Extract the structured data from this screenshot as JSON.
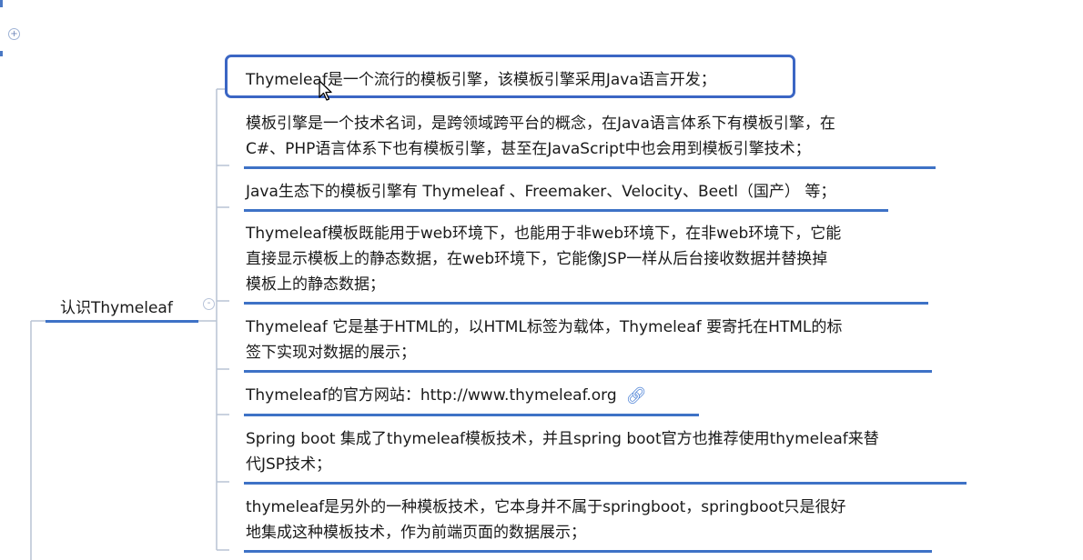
{
  "central_topic": {
    "label": "认识Thymeleaf"
  },
  "topics": [
    {
      "lines": [
        "Thymeleaf是一个流行的模板引擎，该模板引擎采用Java语言开发；"
      ]
    },
    {
      "lines": [
        "模板引擎是一个技术名词，是跨领域跨平台的概念，在Java语言体系下有模板引擎，在",
        "C#、PHP语言体系下也有模板引擎，甚至在JavaScript中也会用到模板引擎技术；"
      ]
    },
    {
      "lines": [
        "Java生态下的模板引擎有 Thymeleaf 、Freemaker、Velocity、Beetl（国产） 等；"
      ]
    },
    {
      "lines": [
        "Thymeleaf模板既能用于web环境下，也能用于非web环境下，在非web环境下，它能",
        "直接显示模板上的静态数据，在web环境下，它能像JSP一样从后台接收数据并替换掉",
        "模板上的静态数据；"
      ]
    },
    {
      "lines": [
        "Thymeleaf 它是基于HTML的，以HTML标签为载体，Thymeleaf 要寄托在HTML的标",
        "签下实现对数据的展示；"
      ]
    },
    {
      "lines": [
        "Thymeleaf的官方网站：http://www.thymeleaf.org"
      ],
      "has_link_icon": true
    },
    {
      "lines": [
        "Spring boot 集成了thymeleaf模板技术，并且spring boot官方也推荐使用thymeleaf来替",
        "代JSP技术；"
      ]
    },
    {
      "lines": [
        "thymeleaf是另外的一种模板技术，它本身并不属于springboot，springboot只是很好",
        "地集成这种模板技术，作为前端页面的数据展示；"
      ]
    }
  ],
  "icons": {
    "expand": "+",
    "collapse": "-",
    "link": "link-icon",
    "cursor": "arrow-cursor-icon"
  },
  "colors": {
    "accent": "#3e72c6",
    "selection": "#3b66c4",
    "connector": "#b9c3d4"
  }
}
